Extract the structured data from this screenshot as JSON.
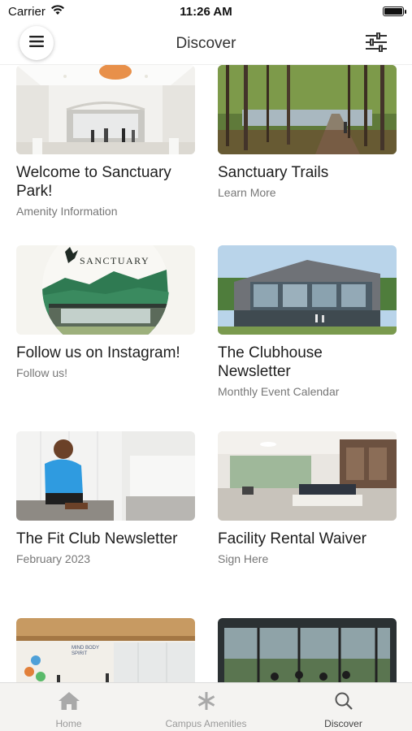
{
  "status": {
    "carrier": "Carrier",
    "time": "11:26 AM"
  },
  "header": {
    "title": "Discover"
  },
  "cards": [
    {
      "title": "Welcome to Sanctuary Park!",
      "subtitle": "Amenity Information"
    },
    {
      "title": "Sanctuary Trails",
      "subtitle": "Learn More"
    },
    {
      "title": "Follow us on Instagram!",
      "subtitle": "Follow us!",
      "image_text": "SANCTUARY"
    },
    {
      "title": "The Clubhouse Newsletter",
      "subtitle": "Monthly Event Calendar"
    },
    {
      "title": "The Fit Club Newsletter",
      "subtitle": "February 2023"
    },
    {
      "title": "Facility Rental Waiver",
      "subtitle": "Sign Here"
    },
    {
      "title": "",
      "subtitle": "",
      "image_text": "MIND BODY SPIRIT"
    },
    {
      "title": "",
      "subtitle": ""
    }
  ],
  "tabs": [
    {
      "label": "Home",
      "icon": "home-icon",
      "active": false
    },
    {
      "label": "Campus Amenities",
      "icon": "asterisk-icon",
      "active": false
    },
    {
      "label": "Discover",
      "icon": "search-icon",
      "active": true
    }
  ]
}
